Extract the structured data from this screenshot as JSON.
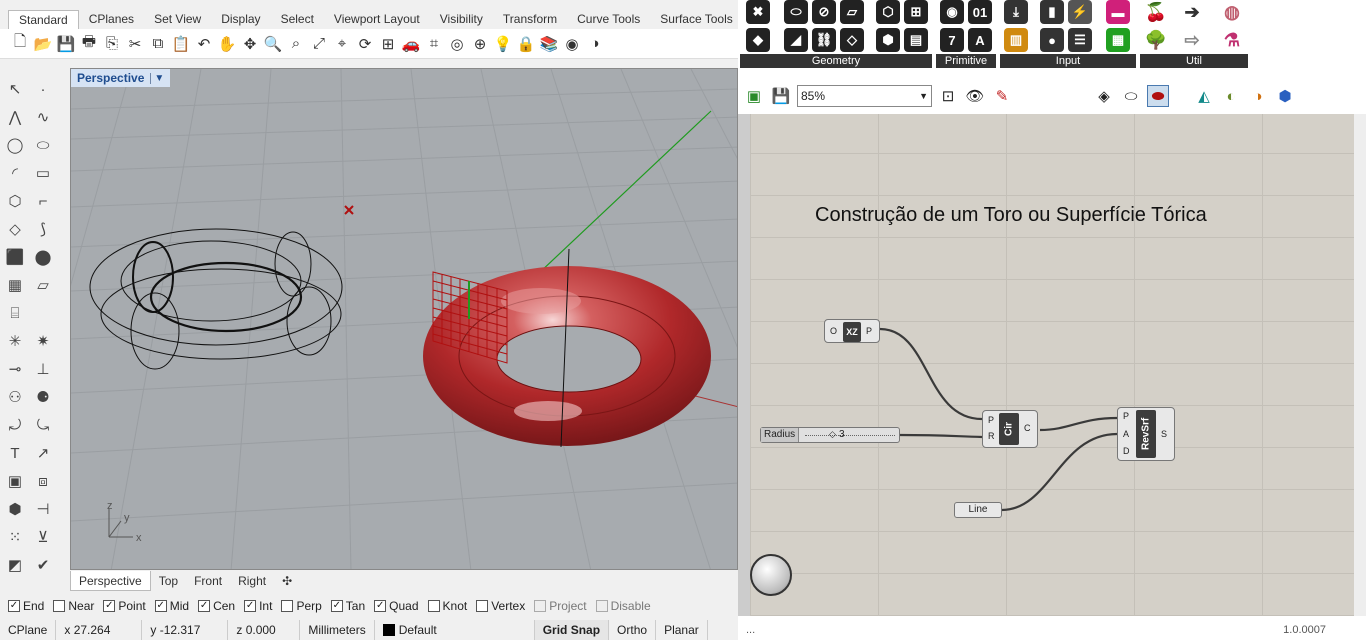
{
  "rhino": {
    "tabs": [
      "Standard",
      "CPlanes",
      "Set View",
      "Display",
      "Select",
      "Viewport Layout",
      "Visibility",
      "Transform",
      "Curve Tools",
      "Surface Tools"
    ],
    "viewport": {
      "title": "Perspective",
      "axes": {
        "x": "x",
        "y": "y",
        "z": "z"
      }
    },
    "viewport_tabs": [
      "Perspective",
      "Top",
      "Front",
      "Right"
    ],
    "osnaps": [
      {
        "label": "End",
        "checked": true
      },
      {
        "label": "Near",
        "checked": false
      },
      {
        "label": "Point",
        "checked": true
      },
      {
        "label": "Mid",
        "checked": true
      },
      {
        "label": "Cen",
        "checked": true
      },
      {
        "label": "Int",
        "checked": true
      },
      {
        "label": "Perp",
        "checked": false
      },
      {
        "label": "Tan",
        "checked": true
      },
      {
        "label": "Quad",
        "checked": true
      },
      {
        "label": "Knot",
        "checked": false
      },
      {
        "label": "Vertex",
        "checked": false
      },
      {
        "label": "Project",
        "checked": false,
        "disabled": true
      },
      {
        "label": "Disable",
        "checked": false,
        "disabled": true
      }
    ],
    "status": {
      "cplane": "CPlane",
      "x": "x 27.264",
      "y": "y -12.317",
      "z": "z 0.000",
      "units": "Millimeters",
      "layer": "Default",
      "grid_snap": "Grid Snap",
      "ortho": "Ortho",
      "planar": "Planar"
    }
  },
  "grasshopper": {
    "ribbon_groups": [
      "Geometry",
      "Primitive",
      "Input",
      "Util"
    ],
    "zoom": "85%",
    "canvas_title": "Construção de um Toro ou Superfície Tórica",
    "components": {
      "xz": {
        "name": "XZ",
        "in": "O",
        "out": "P"
      },
      "slider": {
        "label": "Radius",
        "value": "3"
      },
      "circle": {
        "name": "Cir",
        "inputs": [
          "P",
          "R"
        ],
        "out": "C"
      },
      "revsrf": {
        "name": "RevSrf",
        "inputs": [
          "P",
          "A",
          "D"
        ],
        "out": "S"
      },
      "line": {
        "label": "Line"
      }
    },
    "status_left": "...",
    "version": "1.0.0007"
  },
  "colors": {
    "torus": "#b0282a",
    "canvas": "#d4d0c8",
    "viewport": "#a7abaf",
    "wire": "#3a3a3a"
  }
}
